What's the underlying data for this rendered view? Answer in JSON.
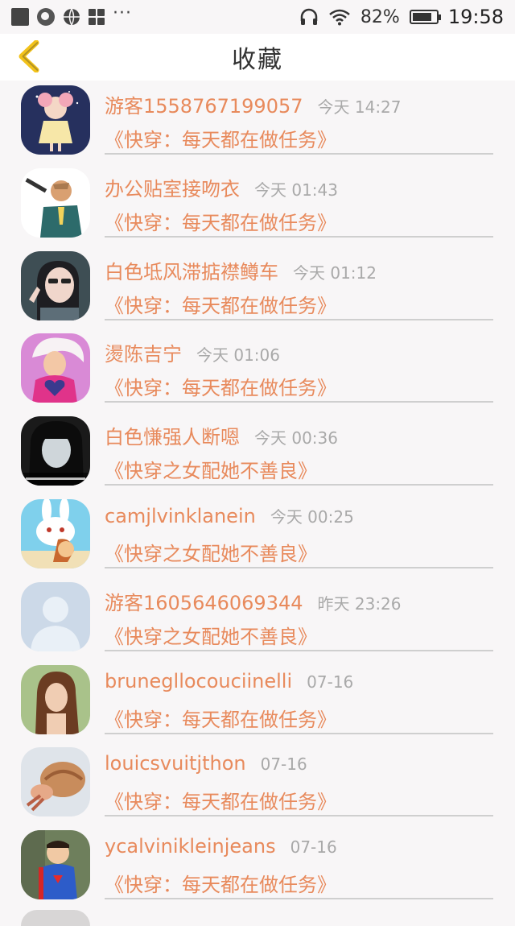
{
  "status_bar": {
    "battery_text": "82%",
    "battery_level": 0.82,
    "time": "19:58",
    "icons": [
      "stop-square-icon",
      "search-icon",
      "globe-icon",
      "apps-icon",
      "more-dots-icon",
      "headphones-icon",
      "wifi-icon",
      "battery-icon"
    ],
    "more_label": "···"
  },
  "header": {
    "title": "收藏",
    "back_icon": "chevron-left-icon",
    "accent_color": "#f2c21a"
  },
  "colors": {
    "name": "#e88a5c",
    "time": "#a9a9a9",
    "divider": "#cfcfcf"
  },
  "items": [
    {
      "user": "游客1558767199057",
      "time": "今天 14:27",
      "book": "《快穿：每天都在做任务》",
      "avatar": "cartoon-girl-avatar"
    },
    {
      "user": "办公贴室接吻衣",
      "time": "今天 01:43",
      "book": "《快穿：每天都在做任务》",
      "avatar": "cartoon-gunman-avatar"
    },
    {
      "user": "白色坻风滞掂襟鳟车",
      "time": "今天 01:12",
      "book": "《快穿：每天都在做任务》",
      "avatar": "selfie-girl-avatar"
    },
    {
      "user": "燙陈吉宁",
      "time": "今天 01:06",
      "book": "《快穿：每天都在做任务》",
      "avatar": "heart-sweater-avatar"
    },
    {
      "user": "白色慊强人断嗯",
      "time": "今天 00:36",
      "book": "《快穿之女配她不善良》",
      "avatar": "dark-hair-girl-avatar"
    },
    {
      "user": "camjlvinklanein",
      "time": "今天 00:25",
      "book": "《快穿之女配她不善良》",
      "avatar": "bunny-avatar"
    },
    {
      "user": "游客1605646069344",
      "time": "昨天 23:26",
      "book": "《快穿之女配她不善良》",
      "avatar": "default-person-avatar"
    },
    {
      "user": "brunegllocouciinelli",
      "time": "07-16",
      "book": "《快穿：每天都在做任务》",
      "avatar": "long-hair-girl-avatar"
    },
    {
      "user": "louicsvuitjthon",
      "time": "07-16",
      "book": "《快穿：每天都在做任务》",
      "avatar": "hermit-crab-avatar"
    },
    {
      "user": "ycalvinikleinjeans",
      "time": "07-16",
      "book": "《快穿：每天都在做任务》",
      "avatar": "superman-kid-avatar"
    }
  ]
}
